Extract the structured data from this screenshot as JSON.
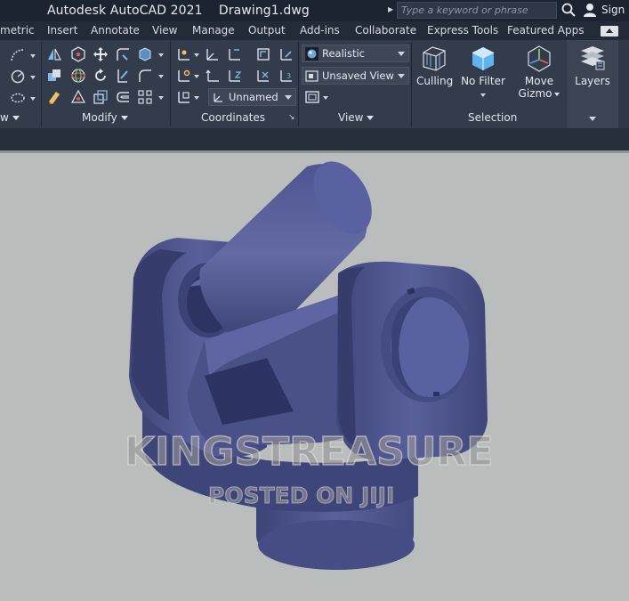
{
  "titlebar": {
    "app_title": "Autodesk AutoCAD 2021    Drawing1.dwg",
    "search_placeholder": "Type a keyword or phrase",
    "signin_label": "Sign In"
  },
  "tabs": [
    "metric",
    "Insert",
    "Annotate",
    "View",
    "Manage",
    "Output",
    "Add-ins",
    "Collaborate",
    "Express Tools",
    "Featured Apps"
  ],
  "ribbon": {
    "panels": {
      "draw_partial": "w",
      "modify": "Modify",
      "coordinates": "Coordinates",
      "view": "View",
      "selection": "Selection"
    },
    "visual_style": "Realistic",
    "named_view": "Unsaved View",
    "ucs_name": "Unnamed",
    "culling_label": "Culling",
    "no_filter_label": "No Filter",
    "move_gizmo_label": "Move Gizmo",
    "move_gizmo_line1": "Move",
    "move_gizmo_line2": "Gizmo",
    "layers_label": "Layers"
  },
  "watermark": {
    "main": "KINGSTREASURE",
    "sub": "POSTED ON JIJI"
  },
  "colors": {
    "titlebar": "#1c2431",
    "ribbon": "#2f3846",
    "viewport": "#b9bdbc",
    "model": "#4a5287"
  }
}
